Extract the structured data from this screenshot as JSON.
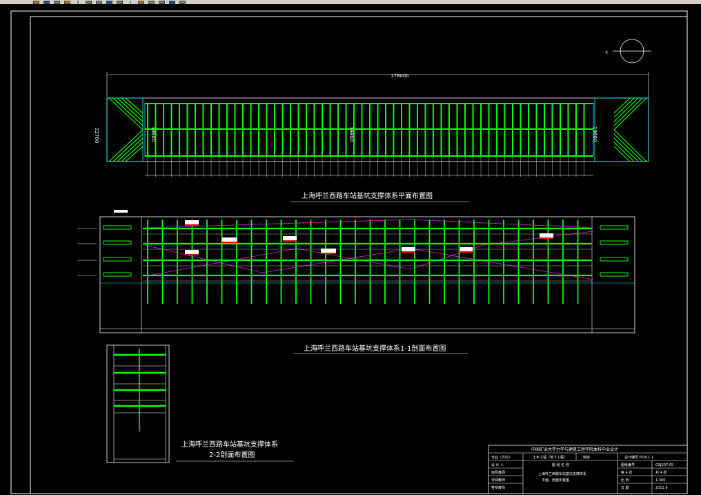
{
  "toolbar": {
    "icons": [
      "new-icon",
      "open-icon",
      "save-icon",
      "print-icon",
      "undo-icon",
      "redo-icon",
      "pan-icon",
      "zoom-icon",
      "properties-icon",
      "layer-icon",
      "match-icon",
      "dist-icon",
      "help-icon"
    ]
  },
  "drawing": {
    "plan": {
      "dimension_overall": "178000",
      "dimension_width": "22700",
      "dimension_mid1": "19800",
      "dimension_mid2": "19800",
      "dimension_mid3": "19800",
      "caption": "上海呼兰西路车站基坑支撑体系平面布置图"
    },
    "section11": {
      "caption": "上海呼兰西路车站基坑支撑体系1-1剖面布置图"
    },
    "section22": {
      "caption_line1": "上海呼兰西路车站基坑支撑体系",
      "caption_line2": "2-2剖面布置图"
    },
    "north_label": "北"
  },
  "title_block": {
    "header": "中国矿业大学力学与建筑工程学院本科毕业设计",
    "row1": [
      "专业（方向）",
      "土木工程（地下工程）",
      "班级",
      "设计编号 P2011-1"
    ],
    "row2_label": "设 计 人",
    "row2_right": [
      "图纸编号",
      "GSJS07-05"
    ],
    "row3_label": "指导教师",
    "row3_right": [
      "第 4 张",
      "共 4 张"
    ],
    "row4_label": "评阅教师",
    "row4_right": [
      "比 例",
      "1:300"
    ],
    "row5_label": "答辩教师",
    "row5_right": [
      "日 期",
      "2011.6"
    ],
    "drawing_name_label": "图 纸 名 称",
    "drawing_name_line1": "上海呼兰西路车站基坑支撑体系",
    "drawing_name_line2": "平面、剖面布置图"
  },
  "colors": {
    "strut": "#00ff00",
    "outline": "#ffffff",
    "magenta": "#ff00ff",
    "cyan": "#00ffff",
    "red": "#ff0000"
  }
}
